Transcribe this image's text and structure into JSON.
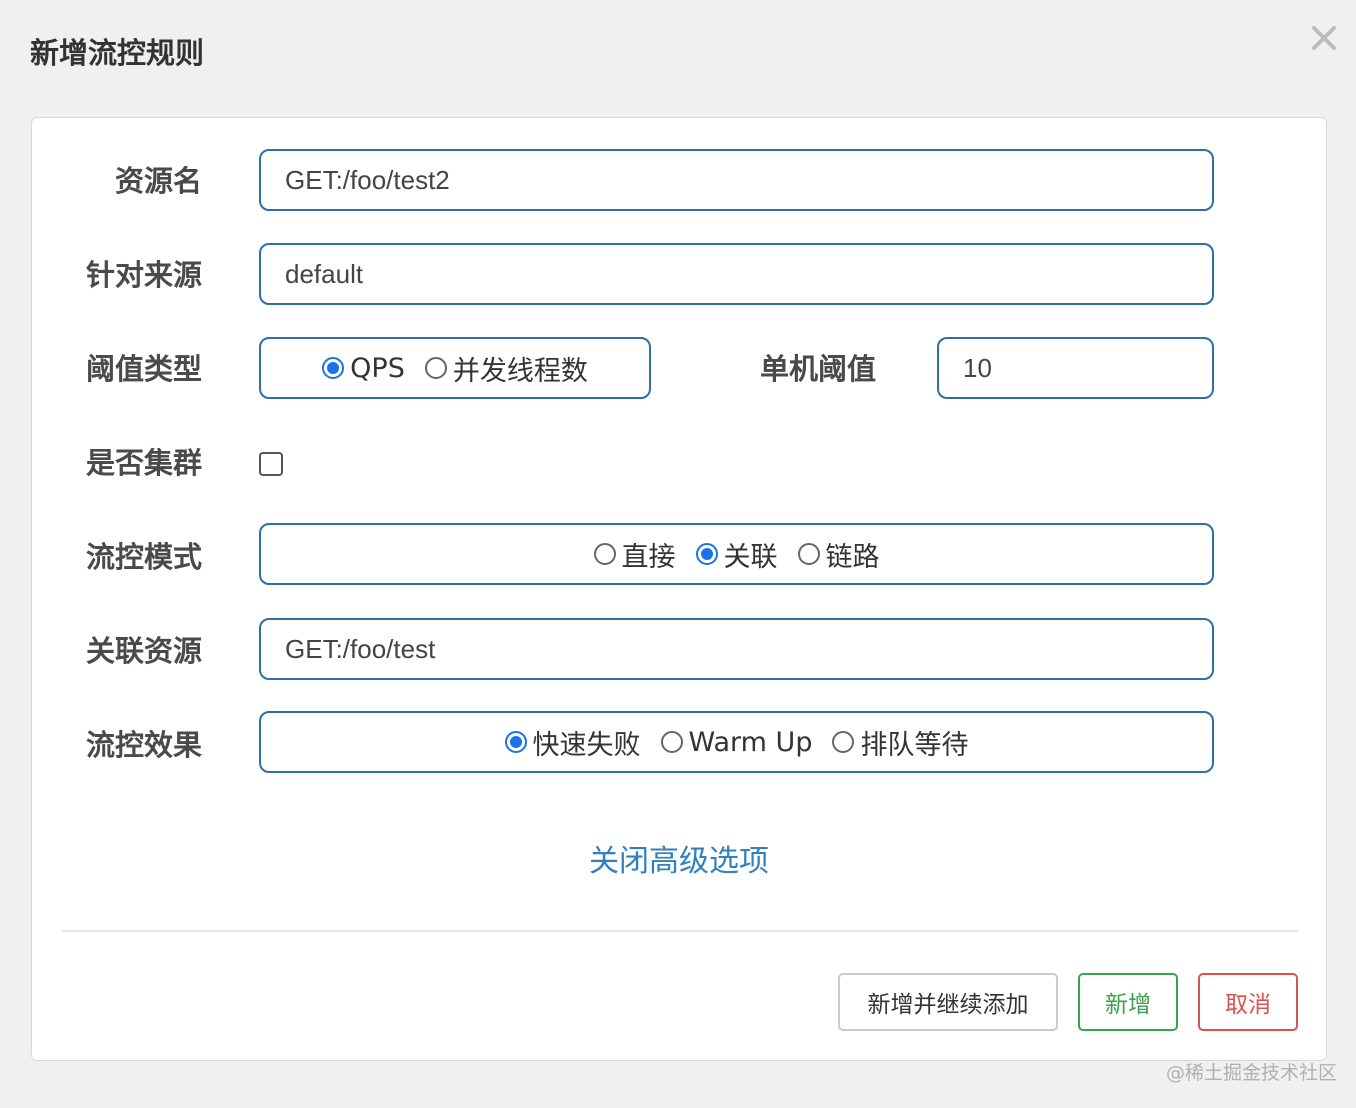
{
  "dialog": {
    "title": "新增流控规则"
  },
  "form": {
    "resource_label": "资源名",
    "resource_value": "GET:/foo/test2",
    "source_label": "针对来源",
    "source_value": "default",
    "threshold_type_label": "阈值类型",
    "threshold_type_options": [
      "QPS",
      "并发线程数"
    ],
    "threshold_type_selected": "QPS",
    "single_threshold_label": "单机阈值",
    "single_threshold_value": "10",
    "cluster_label": "是否集群",
    "cluster_checked": false,
    "mode_label": "流控模式",
    "mode_options": [
      "直接",
      "关联",
      "链路"
    ],
    "mode_selected": "关联",
    "related_resource_label": "关联资源",
    "related_resource_value": "GET:/foo/test",
    "effect_label": "流控效果",
    "effect_options": [
      "快速失败",
      "Warm Up",
      "排队等待"
    ],
    "effect_selected": "快速失败",
    "advanced_toggle": "关闭高级选项"
  },
  "buttons": {
    "add_continue": "新增并继续添加",
    "add": "新增",
    "cancel": "取消"
  },
  "watermark": "@稀土掘金技术社区",
  "colors": {
    "field_border": "#2f6fa8",
    "radio_checked": "#1a73e8",
    "link": "#2f7fc1",
    "add_green": "#3aa24a",
    "cancel_red": "#d9534f"
  }
}
